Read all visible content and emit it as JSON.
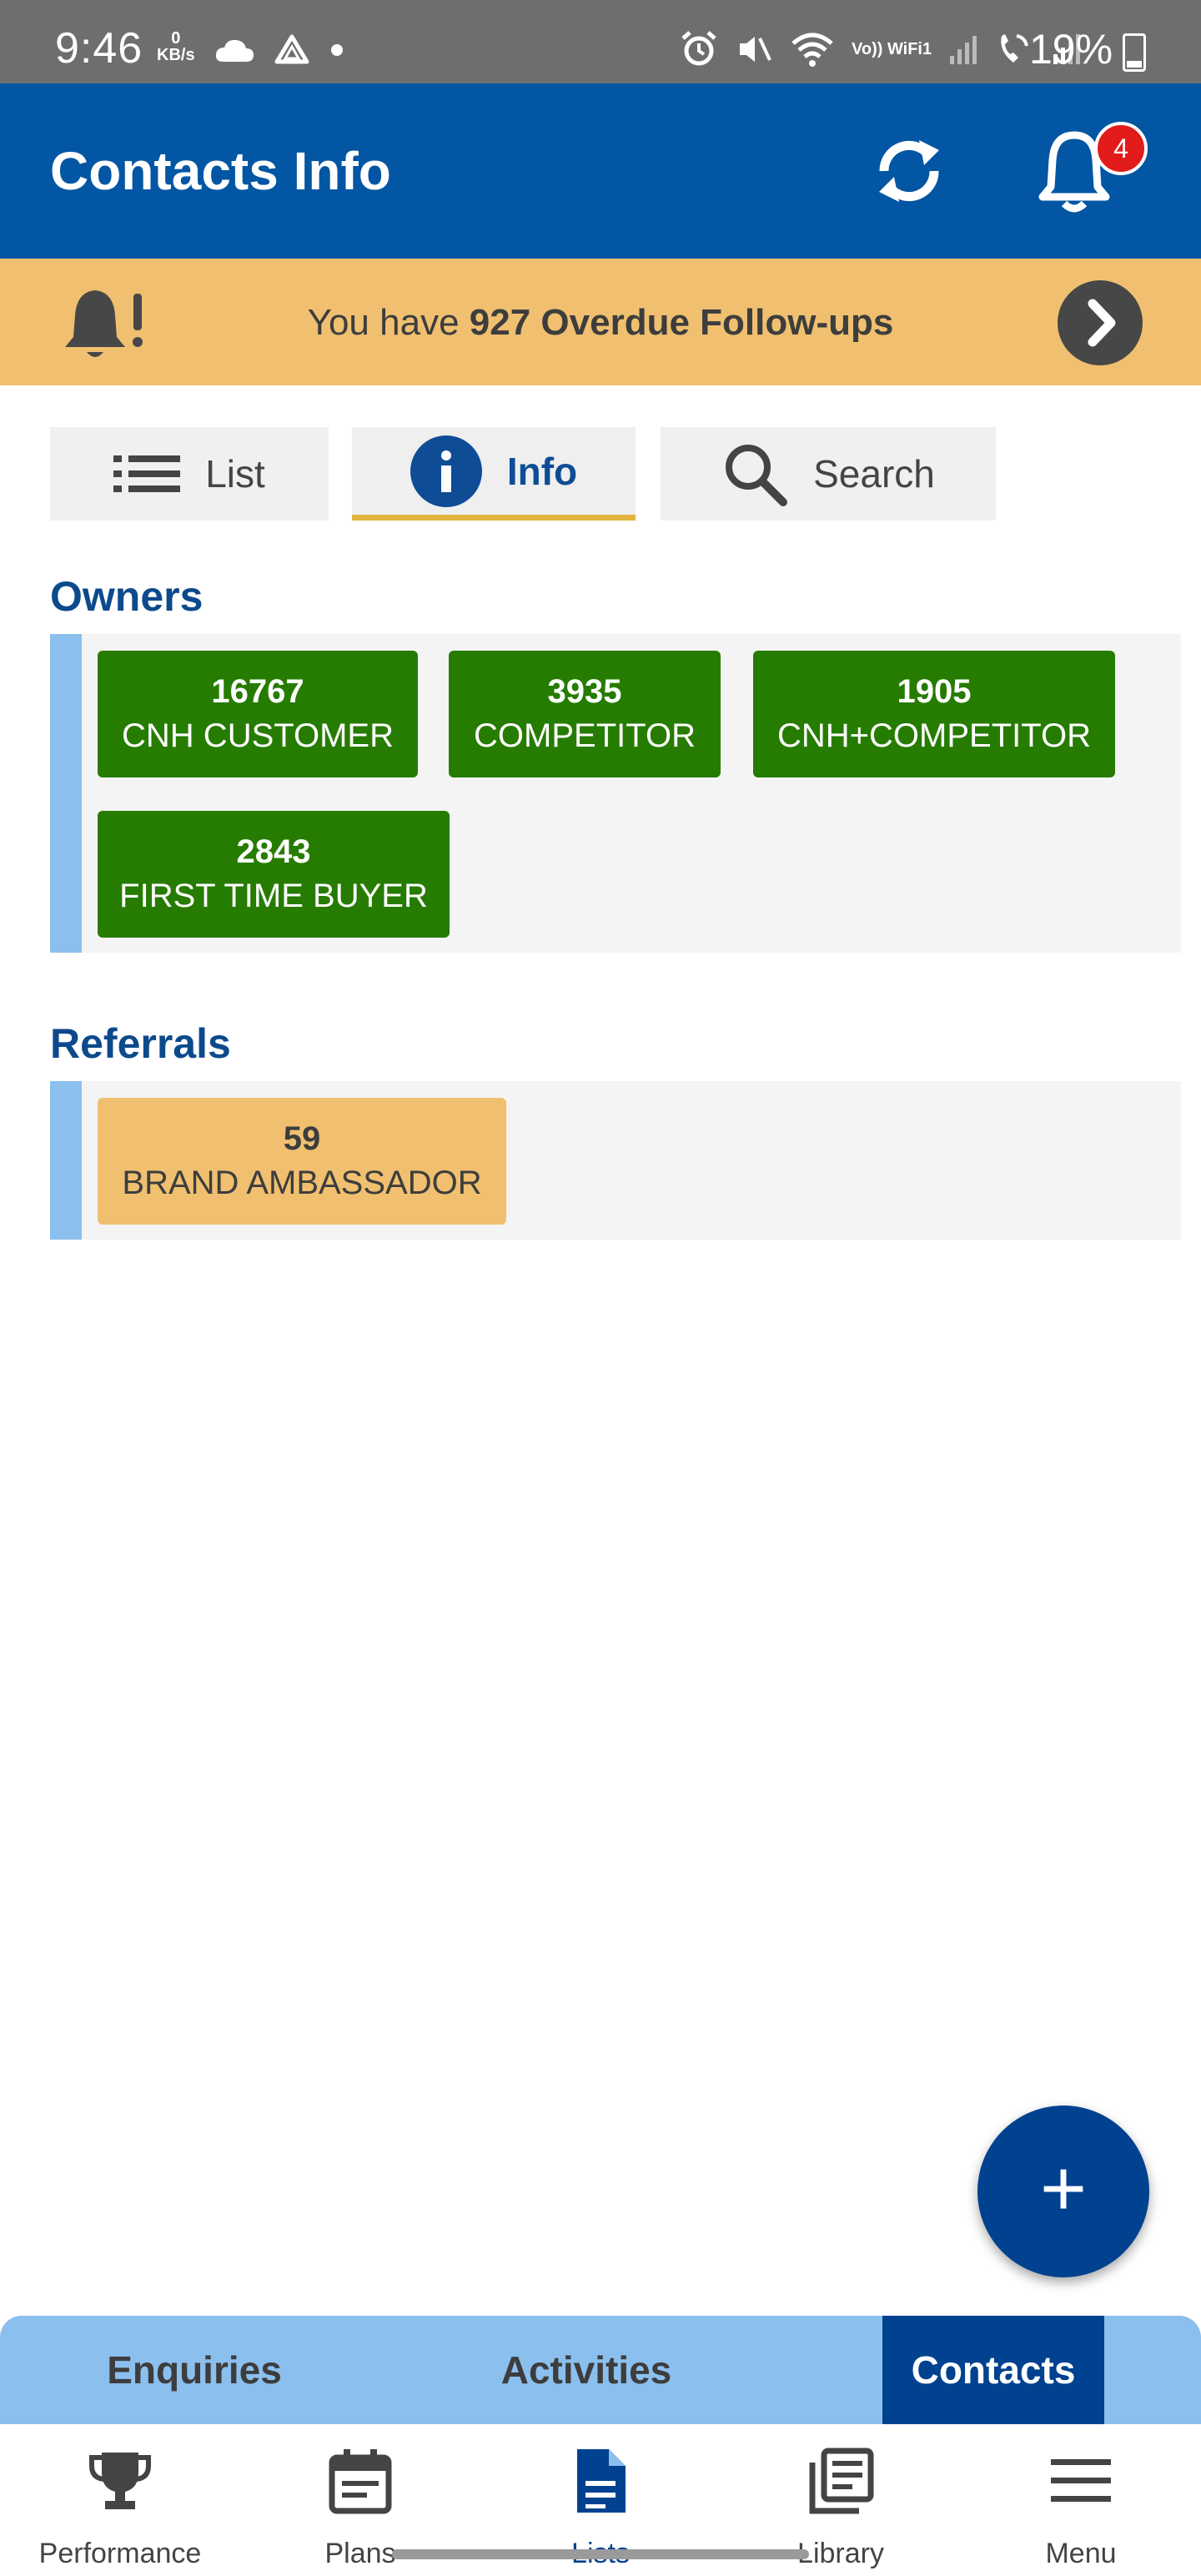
{
  "status_bar": {
    "time": "9:46",
    "net_speed_value": "0",
    "net_speed_unit": "KB/s",
    "wifi_call_label": "Vo)) WiFi1",
    "battery": "19%"
  },
  "header": {
    "title": "Contacts Info",
    "notification_count": "4"
  },
  "banner": {
    "prefix": "You have ",
    "emphasis": "927 Overdue Follow-ups"
  },
  "tabs": [
    {
      "label": "List",
      "icon": "list-icon"
    },
    {
      "label": "Info",
      "icon": "info-icon",
      "active": true
    },
    {
      "label": "Search",
      "icon": "search-icon"
    }
  ],
  "owners": {
    "title": "Owners",
    "chips": [
      {
        "count": "16767",
        "label": "CNH CUSTOMER"
      },
      {
        "count": "3935",
        "label": "COMPETITOR"
      },
      {
        "count": "1905",
        "label": "CNH+COMPETITOR"
      },
      {
        "count": "2843",
        "label": "FIRST TIME BUYER"
      }
    ]
  },
  "referrals": {
    "title": "Referrals",
    "chips": [
      {
        "count": "59",
        "label": "BRAND AMBASSADOR"
      }
    ]
  },
  "fab": {
    "symbol": "+"
  },
  "sub_nav": [
    {
      "label": "Enquiries"
    },
    {
      "label": "Activities"
    },
    {
      "label": "Contacts",
      "active": true
    }
  ],
  "bottom_nav": [
    {
      "label": "Performance",
      "icon": "trophy-icon"
    },
    {
      "label": "Plans",
      "icon": "calendar-icon"
    },
    {
      "label": "Lists",
      "icon": "document-icon",
      "active": true
    },
    {
      "label": "Library",
      "icon": "library-icon"
    },
    {
      "label": "Menu",
      "icon": "hamburger-menu-icon"
    }
  ],
  "colors": {
    "primary": "#0256a3",
    "dark_primary": "#00428f",
    "owner_chip": "#267c00",
    "amber": "#f0c070",
    "stripe": "#8bbfee",
    "badge": "#e21b1b"
  }
}
